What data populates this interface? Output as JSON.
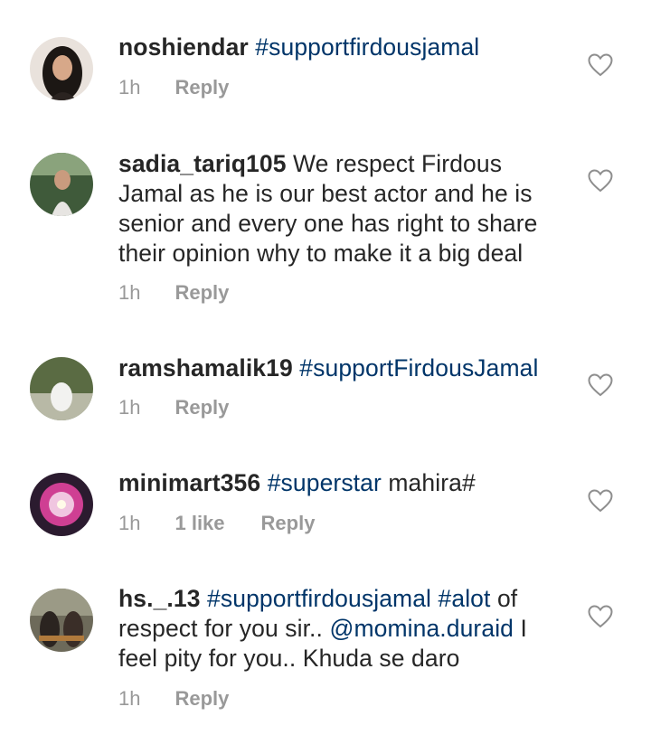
{
  "comments": [
    {
      "username": "noshiendar",
      "segments": [
        " ",
        "#supportfirdousjamal"
      ],
      "time": "1h",
      "likes": "",
      "reply_label": "Reply"
    },
    {
      "username": "sadia_tariq105",
      "text": " We respect Firdous Jamal as he is our best actor and he is senior and every one has right to share their opinion why to make it a big deal",
      "time": "1h",
      "likes": "",
      "reply_label": "Reply"
    },
    {
      "username": "ramshamalik19",
      "tag": "#supportFirdousJamal",
      "time": "1h",
      "likes": "",
      "reply_label": "Reply"
    },
    {
      "username": "minimart356",
      "tag": "#superstar",
      "rest": " mahira#",
      "time": "1h",
      "likes": "1 like",
      "reply_label": "Reply"
    },
    {
      "username": "hs._.13",
      "tag1": "#supportfirdousjamal",
      "tag2": "#alot",
      "text1": " of respect for you sir.. ",
      "mention": "@momina.duraid",
      "text2": " I feel pity for you.. Khuda se daro",
      "time": "1h",
      "likes": "",
      "reply_label": "Reply"
    }
  ],
  "icons": {
    "like": "heart-outline-icon"
  },
  "colors": {
    "text": "#262626",
    "hashtag": "#003569",
    "meta": "#999999"
  }
}
